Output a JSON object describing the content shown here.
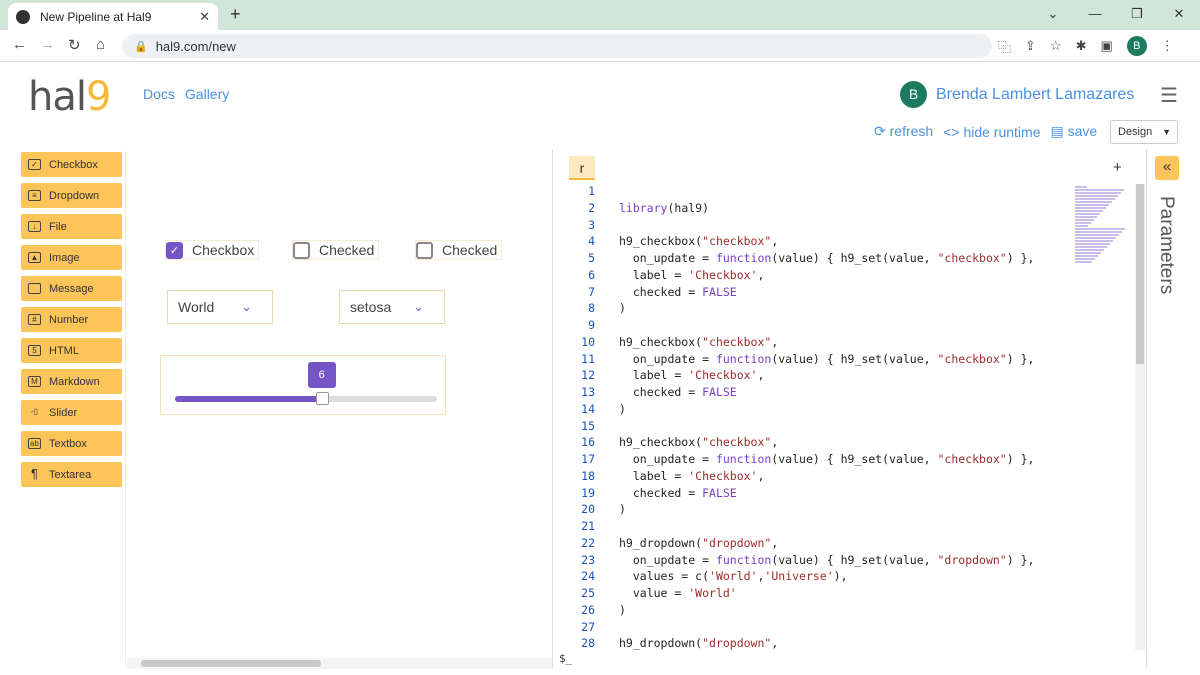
{
  "browser": {
    "tab_title": "New Pipeline at Hal9",
    "url": "hal9.com/new",
    "profile_initial": "B"
  },
  "header": {
    "logo_text": "hal",
    "logo_accent": "9",
    "nav": [
      "Docs",
      "Gallery"
    ],
    "user_initial": "B",
    "user_name": "Brenda Lambert Lamazares",
    "actions": {
      "refresh": "refresh",
      "hide_runtime": "hide runtime",
      "save": "save"
    },
    "mode_select": "Design"
  },
  "palette": [
    {
      "label": "Checkbox",
      "icon": "checkbox-icon"
    },
    {
      "label": "Dropdown",
      "icon": "dropdown-icon"
    },
    {
      "label": "File",
      "icon": "file-icon"
    },
    {
      "label": "Image",
      "icon": "image-icon"
    },
    {
      "label": "Message",
      "icon": "message-icon"
    },
    {
      "label": "Number",
      "icon": "number-icon"
    },
    {
      "label": "HTML",
      "icon": "html-icon"
    },
    {
      "label": "Markdown",
      "icon": "markdown-icon"
    },
    {
      "label": "Slider",
      "icon": "slider-icon"
    },
    {
      "label": "Textbox",
      "icon": "textbox-icon"
    },
    {
      "label": "Textarea",
      "icon": "textarea-icon"
    }
  ],
  "canvas": {
    "checkboxes": [
      {
        "label": "Checkbox",
        "checked": true
      },
      {
        "label": "Checked",
        "checked": false
      },
      {
        "label": "Checked",
        "checked": false
      }
    ],
    "dropdowns": [
      {
        "value": "World"
      },
      {
        "value": "setosa"
      }
    ],
    "slider": {
      "value": "6",
      "fraction": 0.56
    }
  },
  "editor": {
    "tab_label": "r",
    "prompt": "$_",
    "lines": [
      "",
      "library(hal9)",
      "",
      "h9_checkbox(\"checkbox\",",
      "  on_update = function(value) { h9_set(value, \"checkbox\") },",
      "  label = 'Checkbox',",
      "  checked = FALSE",
      ")",
      "",
      "h9_checkbox(\"checkbox\",",
      "  on_update = function(value) { h9_set(value, \"checkbox\") },",
      "  label = 'Checkbox',",
      "  checked = FALSE",
      ")",
      "",
      "h9_checkbox(\"checkbox\",",
      "  on_update = function(value) { h9_set(value, \"checkbox\") },",
      "  label = 'Checkbox',",
      "  checked = FALSE",
      ")",
      "",
      "h9_dropdown(\"dropdown\",",
      "  on_update = function(value) { h9_set(value, \"dropdown\") },",
      "  values = c('World','Universe'),",
      "  value = 'World'",
      ")",
      "",
      "h9_dropdown(\"dropdown\","
    ]
  },
  "parameters_title": "Parameters",
  "colors": {
    "accent": "#7656c7",
    "palette": "#fbc55a",
    "link": "#4a90e2"
  }
}
